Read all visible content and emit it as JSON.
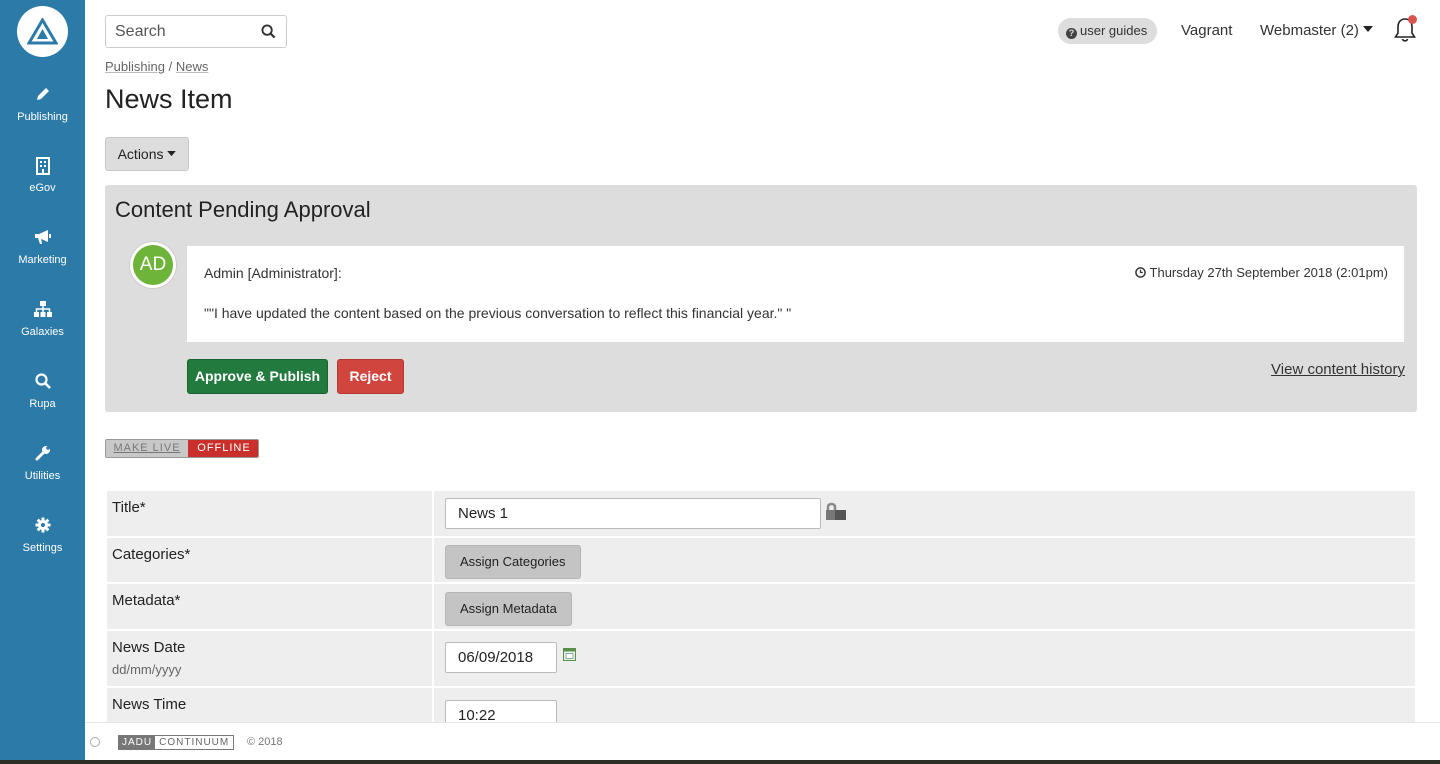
{
  "sidebar": {
    "items": [
      {
        "label": "Publishing",
        "icon": "pencil-icon"
      },
      {
        "label": "eGov",
        "icon": "building-icon"
      },
      {
        "label": "Marketing",
        "icon": "megaphone-icon"
      },
      {
        "label": "Galaxies",
        "icon": "sitemap-icon"
      },
      {
        "label": "Rupa",
        "icon": "search-icon"
      },
      {
        "label": "Utilities",
        "icon": "wrench-icon"
      },
      {
        "label": "Settings",
        "icon": "gear-icon"
      }
    ]
  },
  "header": {
    "search_placeholder": "Search",
    "user_guides": "user guides",
    "site_user": "Vagrant",
    "account": "Webmaster (2)"
  },
  "breadcrumb": {
    "parent": "Publishing",
    "sep": "/",
    "current": "News"
  },
  "page_title": "News Item",
  "actions_label": "Actions",
  "approval": {
    "title": "Content Pending Approval",
    "avatar_initials": "AD",
    "author": "Admin [Administrator]:",
    "date": "Thursday 27th September 2018 (2:01pm)",
    "message": "\"\"I have updated the content based on the previous conversation to reflect this financial year.\" \"",
    "approve_label": "Approve & Publish",
    "reject_label": "Reject",
    "history_label": "View content history"
  },
  "status_toggle": {
    "make_live": "MAKE LIVE",
    "offline": "OFFLINE"
  },
  "form": {
    "title_label": "Title*",
    "title_value": "News 1",
    "categories_label": "Categories*",
    "assign_categories": "Assign Categories",
    "metadata_label": "Metadata*",
    "assign_metadata": "Assign Metadata",
    "news_date_label": "News Date",
    "news_date_hint": "dd/mm/yyyy",
    "news_date_value": "06/09/2018",
    "news_time_label": "News Time",
    "news_time_value": "10:22"
  },
  "footer": {
    "brand_a": "JADU",
    "brand_b": "CONTINUUM",
    "copyright": "© 2018"
  },
  "colors": {
    "sidebar": "#2b7aa8",
    "approve": "#237a3f",
    "reject": "#d0453e",
    "avatar": "#6fb43a",
    "offline": "#c9302c"
  }
}
